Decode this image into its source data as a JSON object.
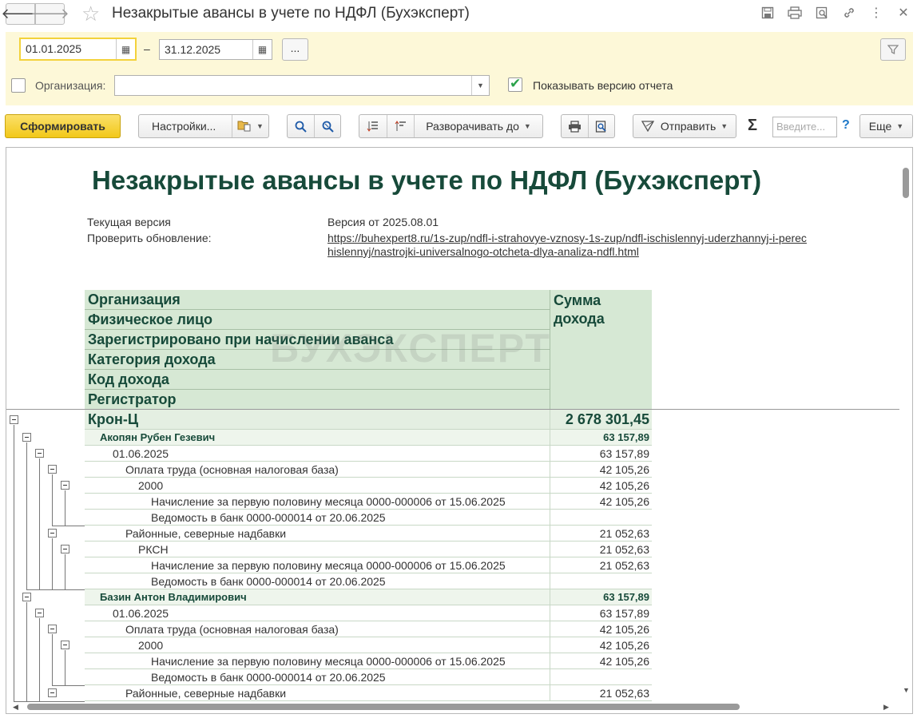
{
  "window": {
    "title": "Незакрытые авансы в учете по НДФЛ (Бухэксперт)",
    "back_icon": "🡐",
    "forward_icon": "🡒"
  },
  "filters": {
    "date_from": "01.01.2025",
    "date_sep": "–",
    "date_to": "31.12.2025",
    "dots_label": "...",
    "org_label": "Организация:",
    "org_value": "",
    "show_version_label": "Показывать версию отчета"
  },
  "toolbar": {
    "form_label": "Сформировать",
    "settings_label": "Настройки...",
    "expand_label": "Разворачивать до",
    "send_label": "Отправить",
    "input_placeholder": "Введите...",
    "more_label": "Еще"
  },
  "report": {
    "title": "Незакрытые авансы в учете по НДФЛ (Бухэксперт)",
    "current_version_label": "Текущая версия",
    "current_version_value": "Версия от 2025.08.01",
    "check_update_label": "Проверить обновление:",
    "update_link_line1": "https://buhexpert8.ru/1s-zup/ndfl-i-strahovye-vznosy-1s-zup/ndfl-ischislennyj-uderzhannyj-i-perec",
    "update_link_line2": "hislennyj/nastrojki-universalnogo-otcheta-dlya-analiza-ndfl.html",
    "watermark": "БУХЭКСПЕРТ",
    "headers": [
      "Организация",
      "Физическое лицо",
      "Зарегистрировано при начислении аванса",
      "Категория дохода",
      "Код дохода",
      "Регистратор"
    ],
    "sum_header_line1": "Сумма",
    "sum_header_line2": "дохода",
    "rows": [
      {
        "level": 0,
        "name": "Крон-Ц",
        "sum": "2 678 301,45"
      },
      {
        "level": 1,
        "name": "Акопян Рубен Гезевич",
        "sum": "63 157,89"
      },
      {
        "level": 2,
        "name": "01.06.2025",
        "sum": "63 157,89"
      },
      {
        "level": 3,
        "name": "Оплата труда (основная налоговая база)",
        "sum": "42 105,26"
      },
      {
        "level": 4,
        "name": "2000",
        "sum": "42 105,26"
      },
      {
        "level": 5,
        "name": "Начисление за первую половину месяца 0000-000006 от 15.06.2025",
        "sum": "42 105,26"
      },
      {
        "level": 5,
        "name": "Ведомость в банк 0000-000014 от 20.06.2025",
        "sum": ""
      },
      {
        "level": 3,
        "name": "Районные, северные надбавки",
        "sum": "21 052,63"
      },
      {
        "level": 4,
        "name": "РКСН",
        "sum": "21 052,63"
      },
      {
        "level": 5,
        "name": "Начисление за первую половину месяца 0000-000006 от 15.06.2025",
        "sum": "21 052,63"
      },
      {
        "level": 5,
        "name": "Ведомость в банк 0000-000014 от 20.06.2025",
        "sum": ""
      },
      {
        "level": 1,
        "name": "Базин Антон Владимирович",
        "sum": "63 157,89"
      },
      {
        "level": 2,
        "name": "01.06.2025",
        "sum": "63 157,89"
      },
      {
        "level": 3,
        "name": "Оплата труда (основная налоговая база)",
        "sum": "42 105,26"
      },
      {
        "level": 4,
        "name": "2000",
        "sum": "42 105,26"
      },
      {
        "level": 5,
        "name": "Начисление за первую половину месяца 0000-000006 от 15.06.2025",
        "sum": "42 105,26"
      },
      {
        "level": 5,
        "name": "Ведомость в банк 0000-000014 от 20.06.2025",
        "sum": ""
      },
      {
        "level": 3,
        "name": "Районные, северные надбавки",
        "sum": "21 052,63"
      }
    ]
  }
}
